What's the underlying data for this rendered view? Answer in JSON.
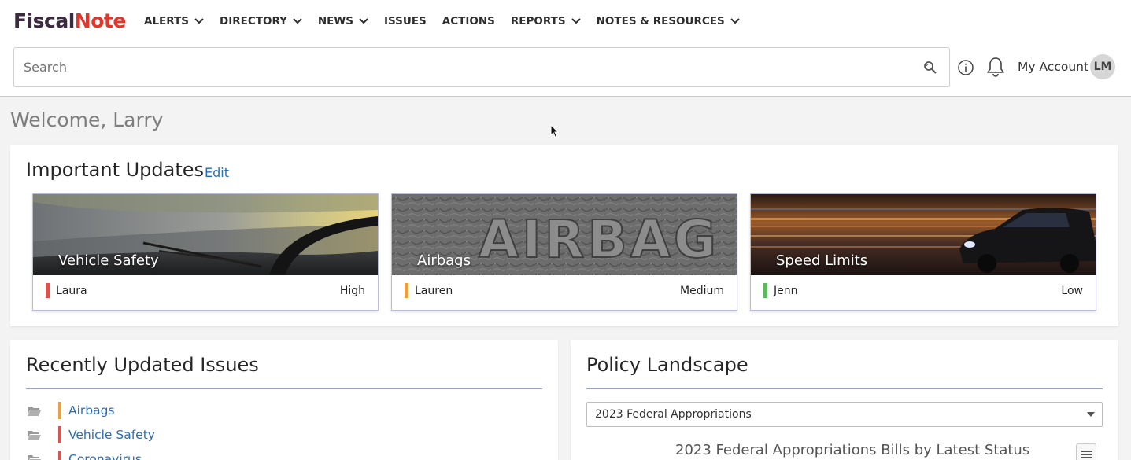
{
  "brand": {
    "part1": "Fiscal",
    "part2": "Note"
  },
  "nav": [
    {
      "label": "ALERTS",
      "dropdown": true
    },
    {
      "label": "DIRECTORY",
      "dropdown": true
    },
    {
      "label": "NEWS",
      "dropdown": true
    },
    {
      "label": "ISSUES",
      "dropdown": false
    },
    {
      "label": "ACTIONS",
      "dropdown": false
    },
    {
      "label": "REPORTS",
      "dropdown": true
    },
    {
      "label": "NOTES & RESOURCES",
      "dropdown": true
    }
  ],
  "search": {
    "placeholder": "Search",
    "value": ""
  },
  "header": {
    "account_label": "My Account",
    "avatar_initials": "LM"
  },
  "welcome": "Welcome, Larry",
  "important_updates": {
    "title": "Important Updates",
    "edit_label": "Edit",
    "tiles": [
      {
        "name": "Vehicle Safety",
        "owner": "Laura",
        "priority": "High",
        "flag_color": "#d9534f"
      },
      {
        "name": "Airbags",
        "owner": "Lauren",
        "priority": "Medium",
        "flag_color": "#e8a040"
      },
      {
        "name": "Speed Limits",
        "owner": "Jenn",
        "priority": "Low",
        "flag_color": "#5cb85c"
      }
    ]
  },
  "recent_issues": {
    "title": "Recently Updated Issues",
    "items": [
      {
        "label": "Airbags",
        "flag_color": "#e8a040"
      },
      {
        "label": "Vehicle Safety",
        "flag_color": "#d9534f"
      },
      {
        "label": "Coronavirus",
        "flag_color": "#d9534f"
      }
    ]
  },
  "policy_landscape": {
    "title": "Policy Landscape",
    "selected": "2023 Federal Appropriations",
    "chart_title": "2023 Federal Appropriations Bills by Latest Status"
  },
  "colors": {
    "brand_dark": "#3b2a40",
    "brand_red": "#e2362b",
    "link": "#2a6db7"
  },
  "icons": [
    "chevron-down-icon",
    "search-icon",
    "info-icon",
    "bell-icon",
    "folder-icon",
    "hamburger-menu-icon"
  ]
}
